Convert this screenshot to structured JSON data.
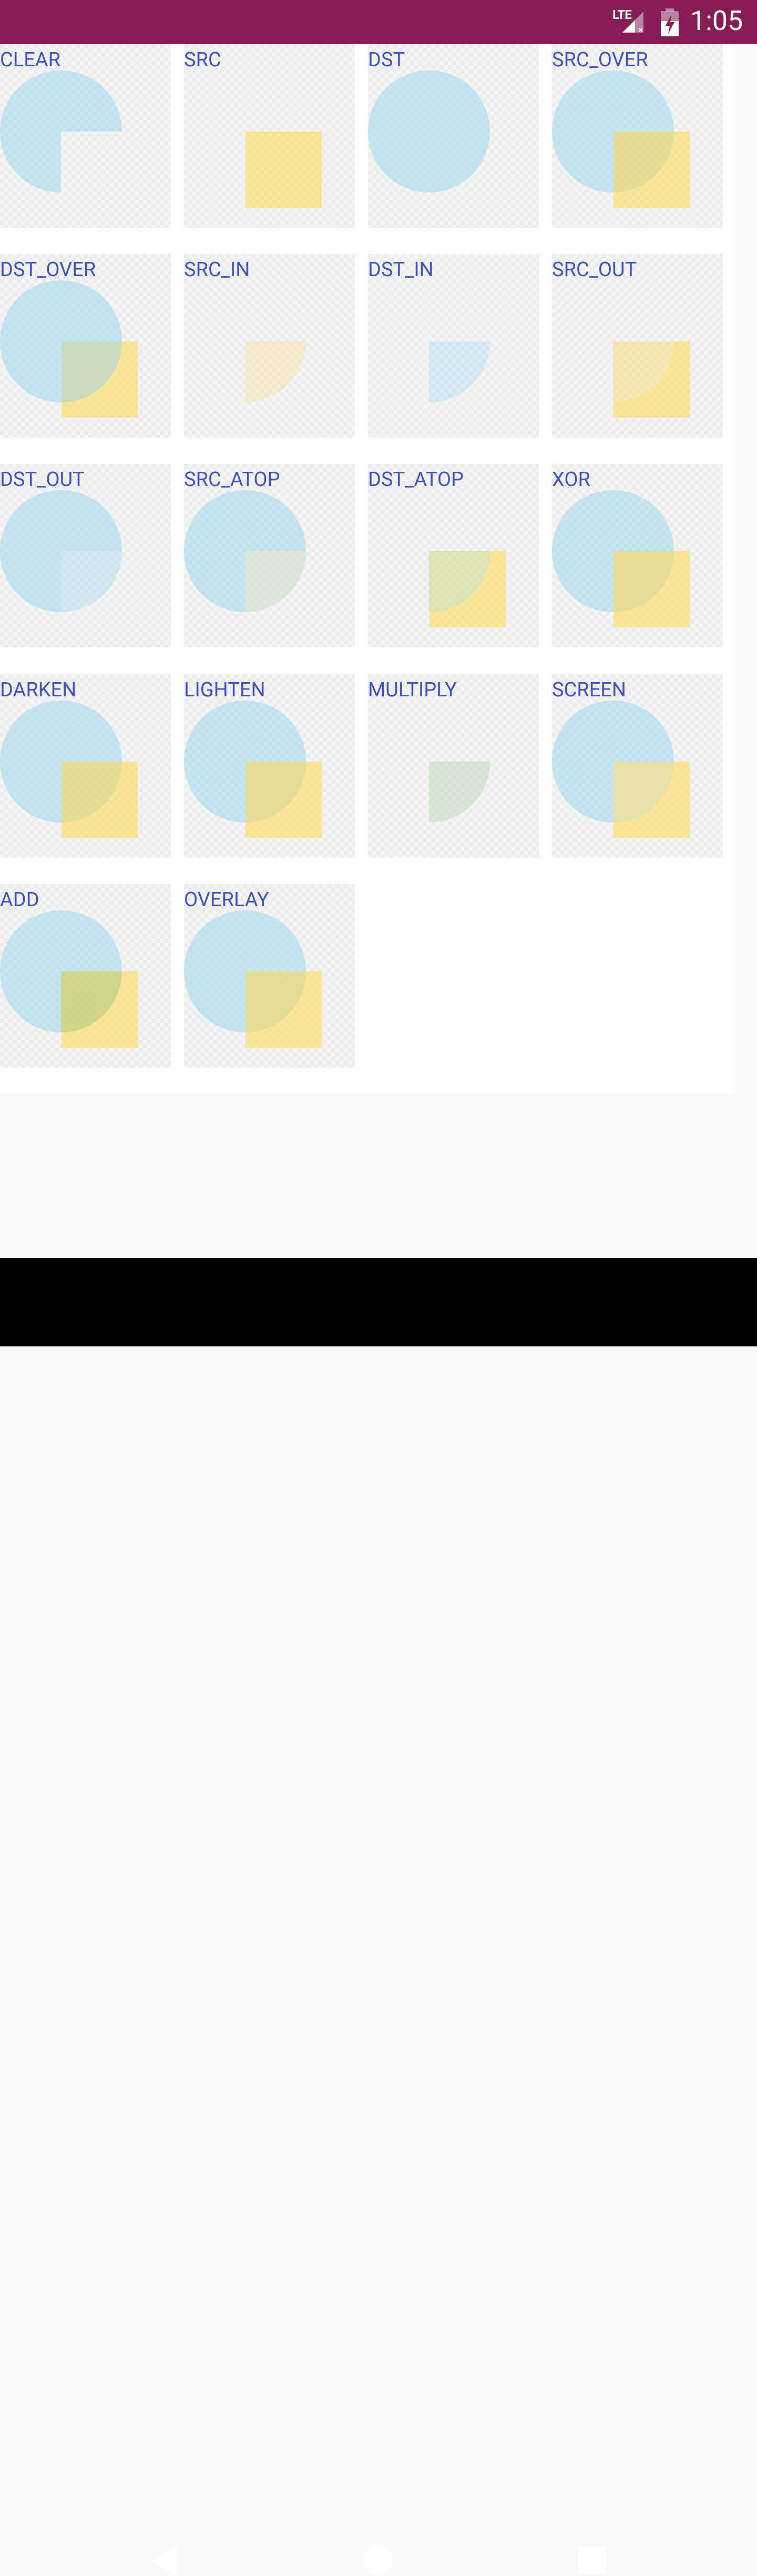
{
  "status_bar": {
    "network": "LTE",
    "time": "1:05",
    "background_color": "#851C54"
  },
  "demo": {
    "label_color": "#3F51B5",
    "src_color": "#FFD84F",
    "dst_color": "#8CD3F0",
    "modes": [
      "CLEAR",
      "SRC",
      "DST",
      "SRC_OVER",
      "DST_OVER",
      "SRC_IN",
      "DST_IN",
      "SRC_OUT",
      "DST_OUT",
      "SRC_ATOP",
      "DST_ATOP",
      "XOR",
      "DARKEN",
      "LIGHTEN",
      "MULTIPLY",
      "SCREEN",
      "ADD",
      "OVERLAY"
    ]
  },
  "nav_bar": {
    "back_icon": "back-icon",
    "home_icon": "home-icon",
    "recents_icon": "recents-icon"
  }
}
